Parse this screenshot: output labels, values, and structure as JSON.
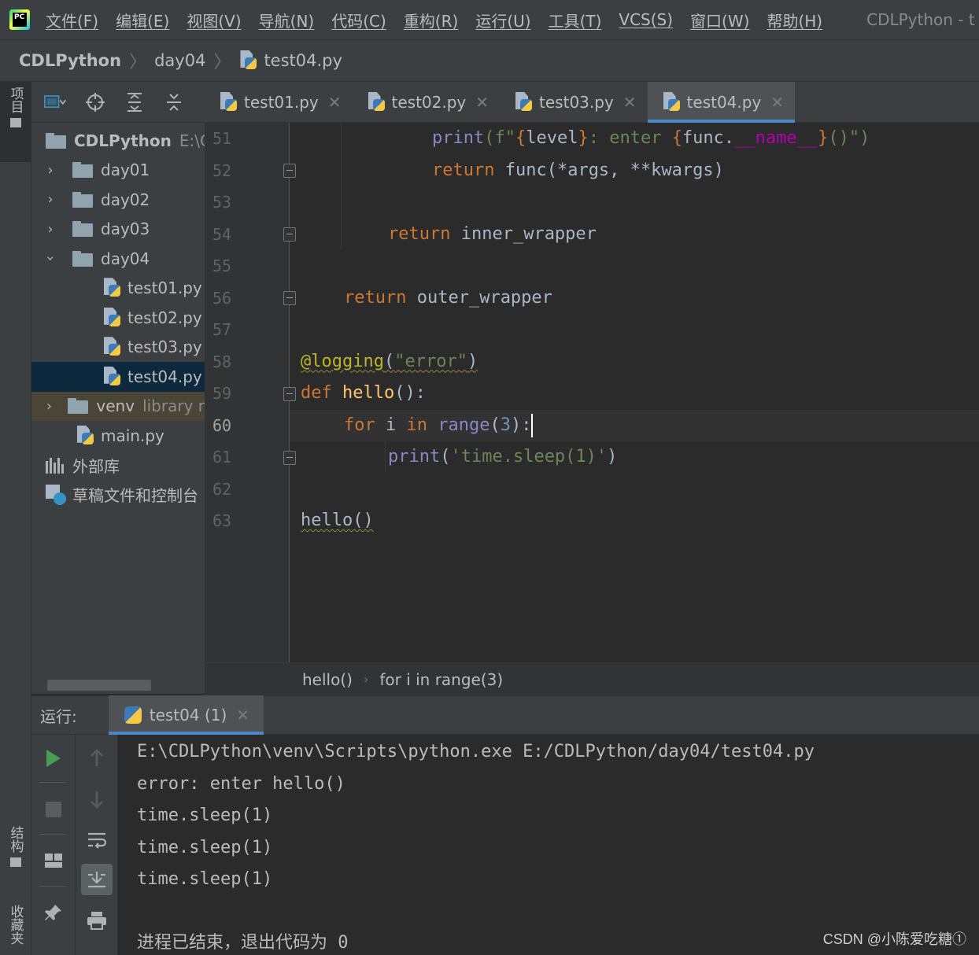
{
  "app": {
    "logo_text": "PC",
    "window_title": "CDLPython - t"
  },
  "menu": [
    "文件(F)",
    "编辑(E)",
    "视图(V)",
    "导航(N)",
    "代码(C)",
    "重构(R)",
    "运行(U)",
    "工具(T)",
    "VCS(S)",
    "窗口(W)",
    "帮助(H)"
  ],
  "breadcrumb": {
    "root": "CDLPython",
    "folder": "day04",
    "file": "test04.py"
  },
  "left_strip": {
    "project": "项目",
    "structure": "结构",
    "favorites": "收藏夹"
  },
  "project_tree": {
    "root_name": "CDLPython",
    "root_path": "E:\\C",
    "day01": "day01",
    "day02": "day02",
    "day03": "day03",
    "day04": "day04",
    "file1": "test01.py",
    "file2": "test02.py",
    "file3": "test03.py",
    "file4": "test04.py",
    "venv": "venv",
    "venv_note": "library r",
    "main": "main.py",
    "external": "外部库",
    "scratches": "草稿文件和控制台"
  },
  "editor_tabs": [
    "test01.py",
    "test02.py",
    "test03.py",
    "test04.py"
  ],
  "gutter": [
    "51",
    "52",
    "53",
    "54",
    "55",
    "56",
    "57",
    "58",
    "59",
    "60",
    "61",
    "62",
    "63"
  ],
  "code": {
    "l51": {
      "print": "print",
      "open": "(f\"",
      "b1": "{",
      "level": "level",
      "b2": "}",
      "mid": ": enter ",
      "b3": "{",
      "func": "func.",
      "dunder": "__name__",
      "b4": "}",
      "tail": "()\")",
      "close": ")"
    },
    "l52": {
      "kw": "return",
      "rest": " func(*args, **kwargs)"
    },
    "l54": {
      "kw": "return",
      "rest": " inner_wrapper"
    },
    "l56": {
      "kw": "return",
      "rest": " outer_wrapper"
    },
    "l58": {
      "dec": "@logging",
      "open": "(",
      "str": "\"error\"",
      "close": ")"
    },
    "l59": {
      "kw": "def",
      "name": " hello",
      "rest": "():"
    },
    "l60": {
      "kw_for": "for",
      "i": " i ",
      "kw_in": "in",
      "sp": " ",
      "range": "range",
      "open": "(",
      "num": "3",
      "close": "):"
    },
    "l61": {
      "print": "print",
      "open": "(",
      "str": "'time.sleep(1)'",
      "close": ")"
    },
    "l63": {
      "call": "hello()"
    }
  },
  "editor_crumbs": [
    "hello()",
    "for i in range(3)"
  ],
  "run": {
    "label": "运行:",
    "tab": "test04 (1)",
    "output": [
      "E:\\CDLPython\\venv\\Scripts\\python.exe E:/CDLPython/day04/test04.py",
      "error: enter hello()",
      "time.sleep(1)",
      "time.sleep(1)",
      "time.sleep(1)",
      "",
      "进程已结束，退出代码为 0"
    ]
  },
  "watermark": "CSDN @小陈爱吃糖①"
}
